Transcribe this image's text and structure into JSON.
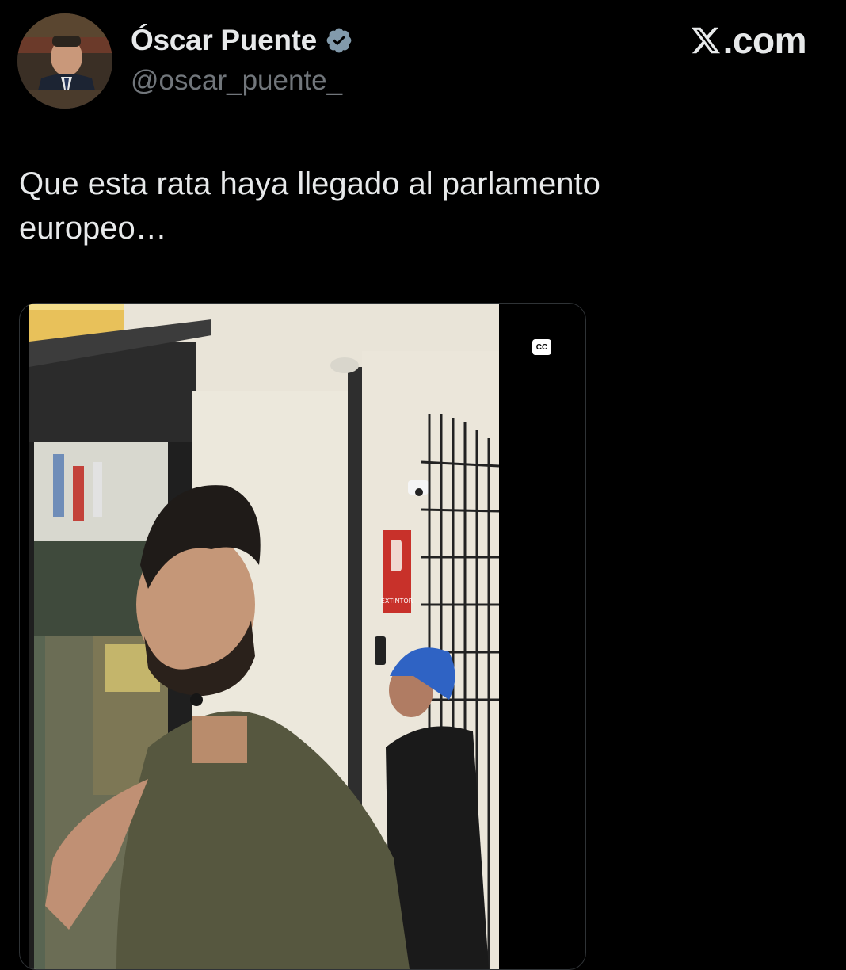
{
  "tweet": {
    "display_name": "Óscar Puente",
    "handle": "@oscar_puente_",
    "verified": true,
    "text": "Que esta rata haya llegado al parlamento europeo…",
    "avatar_icon": "profile-photo"
  },
  "brand": {
    "watermark": "X.com",
    "icon": "x-logo-icon"
  },
  "media": {
    "type": "video",
    "cc_label": "CC",
    "frame_sign": "EXTINTOR"
  },
  "colors": {
    "background": "#000000",
    "text_primary": "#e7e9ea",
    "text_secondary": "#71767b",
    "verified_badge": "#829aab"
  }
}
